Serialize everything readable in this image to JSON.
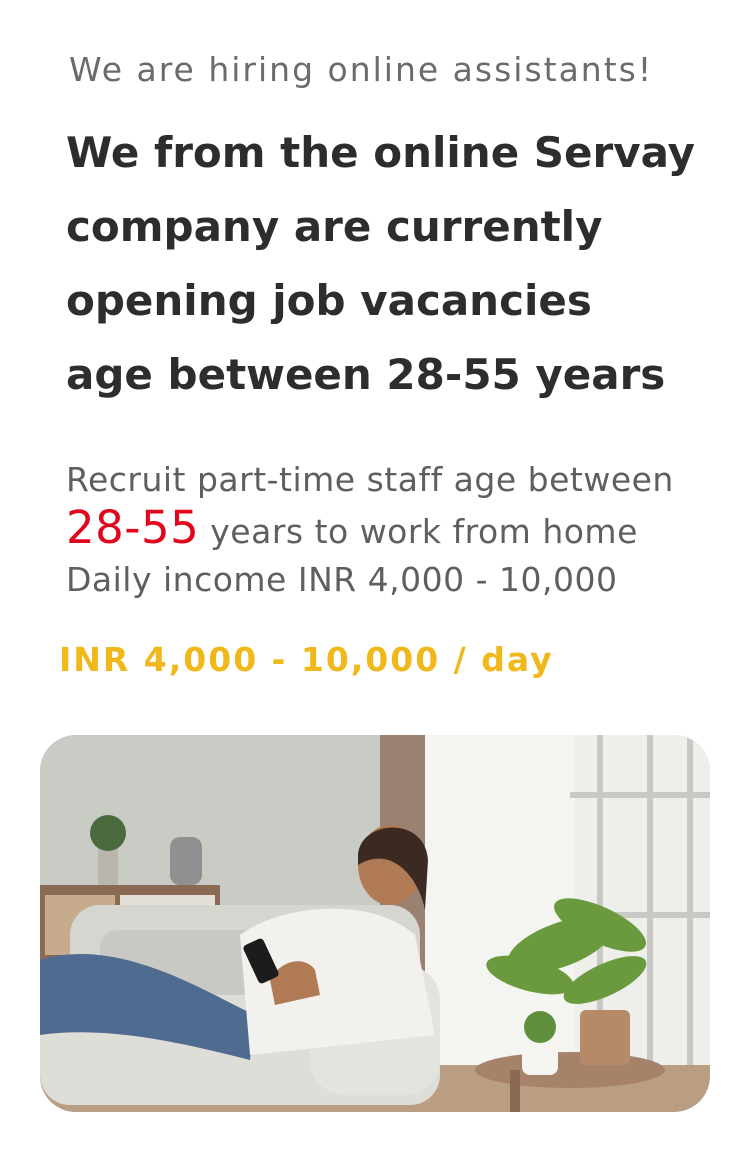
{
  "tagline": "We are hiring online assistants!",
  "headline": {
    "lines": [
      "We from the online Servay",
      "company are currently",
      "opening job vacancies",
      "age between 28-55 years"
    ]
  },
  "description": {
    "line1": "Recruit part-time staff age between",
    "age_range": "28-55",
    "line2_suffix": "years to work from home",
    "line3": "Daily income INR 4,000 - 10,000"
  },
  "salary": "INR 4,000 - 10,000 / day",
  "colors": {
    "headline": "#2d2d2d",
    "accent_red": "#e1061b",
    "accent_gold": "#f0b81a",
    "muted_text": "#6b6b6b"
  },
  "photo": {
    "icon": "woman-on-sofa-with-phone-photo"
  }
}
